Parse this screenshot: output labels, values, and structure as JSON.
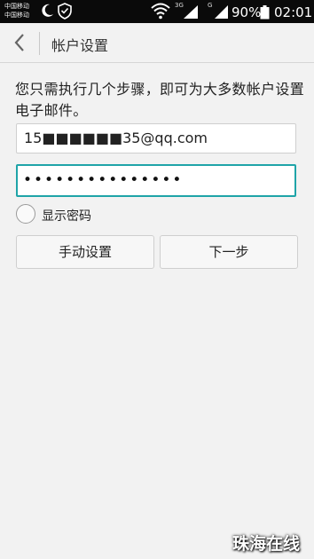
{
  "status_bar": {
    "carrier1": "中国移动",
    "carrier2": "中国移动",
    "net1": "3G",
    "net2": "G",
    "battery": "90%",
    "time": "02:01"
  },
  "header": {
    "title": "帐户设置",
    "back_icon": "chevron-left-icon"
  },
  "main": {
    "description": "您只需执行几个步骤，即可为大多数帐户设置电子邮件。",
    "email_value": "15■■■■■■35@qq.com",
    "password_value": "•••••••••••••••",
    "show_password_label": "显示密码",
    "show_password_checked": false,
    "manual_setup_label": "手动设置",
    "next_label": "下一步",
    "accent_color": "#1fa4a8"
  },
  "watermark": "珠海在线"
}
